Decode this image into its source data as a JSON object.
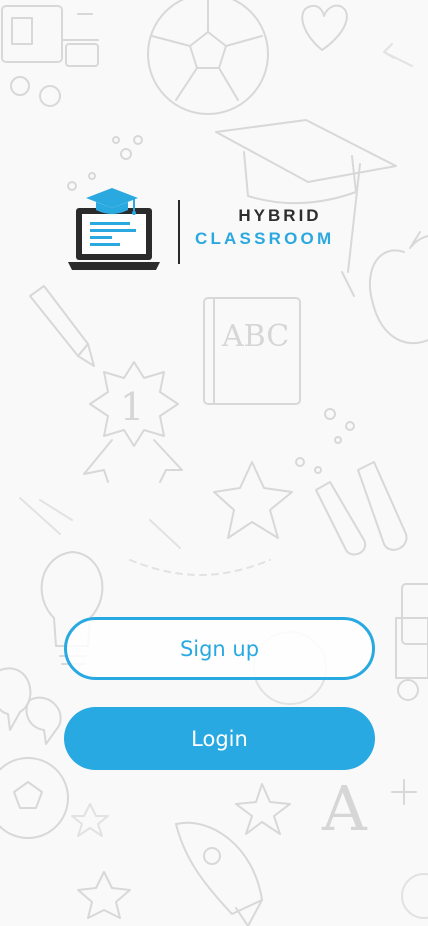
{
  "app": {
    "logo": {
      "line1": "HYBRID",
      "line2": "CLASSROOM"
    }
  },
  "actions": {
    "signup_label": "Sign up",
    "login_label": "Login"
  },
  "background": {
    "doodle_text_abc": "ABC",
    "doodle_text_one": "1",
    "doodle_text_a": "A"
  },
  "colors": {
    "accent": "#29a9e1",
    "logo_dark": "#2e2e2e",
    "background": "#f9f9f9"
  }
}
